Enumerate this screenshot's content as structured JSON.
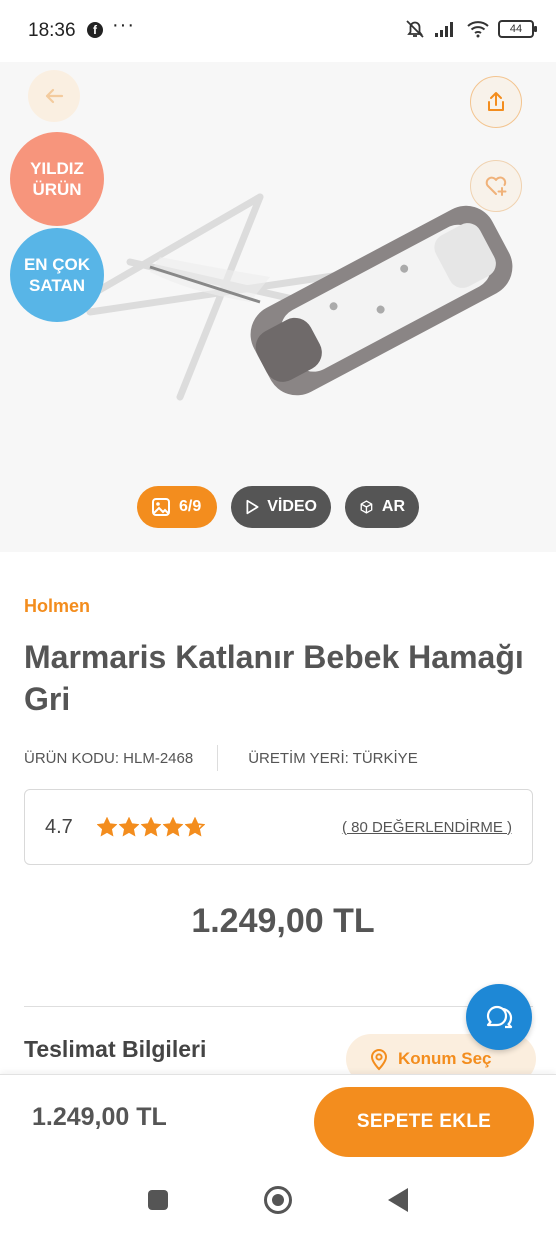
{
  "status_bar": {
    "time": "18:36",
    "facebook_glyph": "f",
    "more_glyph": "···",
    "battery": "44"
  },
  "product_image": {
    "badges": {
      "star": "YILDIZ ÜRÜN",
      "best_seller": "EN ÇOK SATAN"
    },
    "image_counter": "6/9",
    "video_label": "VİDEO",
    "ar_label": "AR"
  },
  "product": {
    "brand": "Holmen",
    "title": "Marmaris Katlanır Bebek Hamağı Gri",
    "code": "ÜRÜN KODU: HLM-2468",
    "origin": "ÜRETİM YERİ: TÜRKİYE",
    "rating": "4.7",
    "rating_value": 4.7,
    "rating_max": 5,
    "reviews": "( 80 DEĞERLENDİRME )",
    "price": "1.249,00 TL"
  },
  "delivery": {
    "title": "Teslimat Bilgileri",
    "location_button": "Konum Seç"
  },
  "bottom_bar": {
    "price": "1.249,00 TL",
    "add_to_cart": "SEPETE EKLE"
  },
  "colors": {
    "accent": "#f38d1e",
    "star_badge": "#f7957c",
    "best_badge": "#58b5e7",
    "chat": "#1e88d6"
  }
}
